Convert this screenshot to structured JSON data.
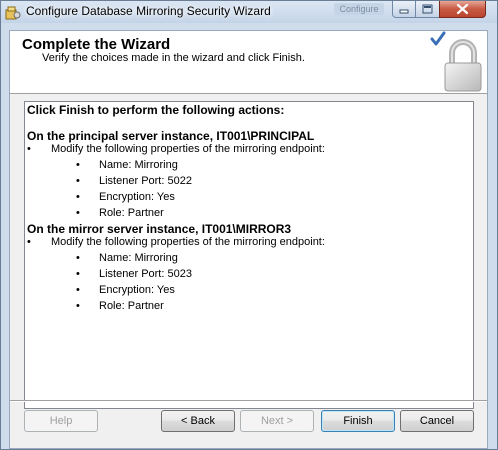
{
  "window": {
    "title": "Configure Database Mirroring Security Wizard",
    "ghost_title": "Configure"
  },
  "header": {
    "title": "Complete the Wizard",
    "subtitle": "Verify the choices made in the wizard and click Finish."
  },
  "summary": {
    "intro": "Click Finish to perform the following actions:",
    "sections": [
      {
        "heading": "On the principal server instance, IT001\\PRINCIPAL",
        "action": "Modify the following properties of the mirroring endpoint:",
        "properties": [
          "Name: Mirroring",
          "Listener Port: 5022",
          "Encryption: Yes",
          "Role: Partner"
        ]
      },
      {
        "heading": "On the mirror server instance, IT001\\MIRROR3",
        "action": "Modify the following properties of the mirroring endpoint:",
        "properties": [
          "Name: Mirroring",
          "Listener Port: 5023",
          "Encryption: Yes",
          "Role: Partner"
        ]
      }
    ]
  },
  "buttons": {
    "help": "Help",
    "back": "< Back",
    "next": "Next >",
    "finish": "Finish",
    "cancel": "Cancel"
  },
  "icons": {
    "app": "wizard-app-icon",
    "header": "padlock-checkmark-icon"
  },
  "colors": {
    "window_frame": "#cfdcec",
    "close_button": "#c85a45",
    "header_band": "#ffffff",
    "default_button_border": "#3c7fb1"
  }
}
